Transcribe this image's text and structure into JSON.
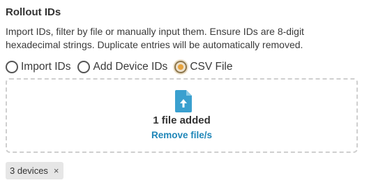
{
  "section": {
    "title": "Rollout IDs",
    "description": "Import IDs, filter by file or manually input them. Ensure IDs are 8-digit hexadecimal strings. Duplicate entries will be automatically removed."
  },
  "source_options": [
    {
      "label": "Import IDs",
      "selected": false
    },
    {
      "label": "Add Device IDs",
      "selected": false
    },
    {
      "label": "CSV File",
      "selected": true
    }
  ],
  "dropzone": {
    "icon": "file-upload-icon",
    "status_text": "1 file added",
    "remove_label": "Remove file/s"
  },
  "device_chip": {
    "label": "3 devices",
    "close_symbol": "×"
  },
  "colors": {
    "accent_link": "#1f86b8",
    "file_icon": "#3aa0cf",
    "radio_selected": "#e8a33c",
    "chip_background": "#e6e6e6",
    "dropzone_border": "#cfcfcf"
  }
}
